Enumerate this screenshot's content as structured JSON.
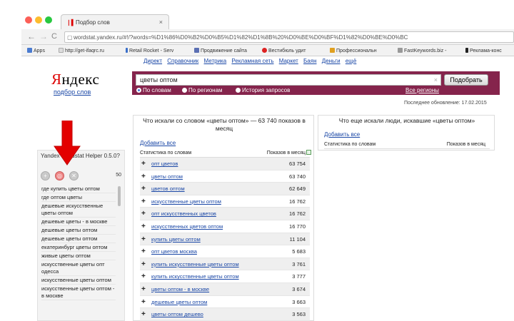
{
  "browser": {
    "tab_title": "Подбор слов",
    "tab_close": "×",
    "url": "wordstat.yandex.ru/#!/?words=%D1%86%D0%B2%D0%B5%D1%82%D1%8B%20%D0%BE%D0%BF%D1%82%D0%BE%D0%BC",
    "nav": {
      "back": "←",
      "forward": "→",
      "reload": "C"
    }
  },
  "bookmarks": [
    {
      "label": "Apps",
      "color": "#4a7bd0"
    },
    {
      "label": "http://get-ifaqrc.ru",
      "color": "#dddddd"
    },
    {
      "label": "Retail Rocket - Serv",
      "color": "#3a6fc9"
    },
    {
      "label": "Продвижение сайта",
      "color": "#5b6fb3"
    },
    {
      "label": "Вестибюль удит",
      "color": "#d22"
    },
    {
      "label": "Профессиональн",
      "color": "#e0a020"
    },
    {
      "label": "FastKeywords.biz - ",
      "color": "#999999"
    },
    {
      "label": "Реклама-конс",
      "color": "#222222"
    }
  ],
  "topnav": [
    "Директ",
    "Справочник",
    "Метрика",
    "Рекламная сеть",
    "Маркет",
    "Баян",
    "Деньги",
    "ещё"
  ],
  "logo": {
    "brand_first": "Я",
    "brand_rest": "ндекс",
    "subtitle": "подбор слов"
  },
  "search": {
    "query": "цветы оптом",
    "clear": "×",
    "submit_label": "Подобрать",
    "modes": [
      {
        "label": "По словам",
        "selected": true
      },
      {
        "label": "По регионам",
        "selected": false
      },
      {
        "label": "История запросов",
        "selected": false
      }
    ],
    "all_regions": "Все регионы"
  },
  "updated": "Последнее обновление: 17.02.2015",
  "plugin": {
    "title": "Yandex Wordstat Helper 0.5.0",
    "help": "?",
    "count": "50",
    "buttons": [
      "+",
      "◎",
      "✕"
    ],
    "items": [
      "где купить цветы оптом",
      "где оптом цветы",
      "дешевые искусственные цветы оптом",
      "дешевые цветы - в москве",
      "дешевые цветы оптом",
      "дешевые цветы оптом",
      "екатеринбург цветы оптом",
      "живые цветы оптом",
      "искусственные цветы опт одесса",
      "искусственные цветы оптом",
      "искусственные цветы оптом - в москве"
    ]
  },
  "main_table": {
    "heading": "Что искали со словом «цветы оптом» — 63 740 показов в месяц",
    "add_all": "Добавить все",
    "col_words": "Статистика по словам",
    "col_shows": "Показов в месяц",
    "rows": [
      {
        "keyword": "опт цветов",
        "count": "63 754"
      },
      {
        "keyword": "цветы оптом",
        "count": "63 740"
      },
      {
        "keyword": "цветов оптом",
        "count": "62 649"
      },
      {
        "keyword": "искусственные цветы оптом",
        "count": "16 762"
      },
      {
        "keyword": "опт искусственных цветов",
        "count": "16 762"
      },
      {
        "keyword": "искусственных цветов оптом",
        "count": "16 770"
      },
      {
        "keyword": "купить цветы оптом",
        "count": "11 104"
      },
      {
        "keyword": "опт цветов москва",
        "count": "5 683"
      },
      {
        "keyword": "купить искусственные цветы оптом",
        "count": "3 761"
      },
      {
        "keyword": "купить искусственные цветы оптом",
        "count": "3 777"
      },
      {
        "keyword": "цветы оптом - в москве",
        "count": "3 674"
      },
      {
        "keyword": "дешевые цветы оптом",
        "count": "3 663"
      },
      {
        "keyword": "цветы оптом дешево",
        "count": "3 563"
      }
    ]
  },
  "side_table": {
    "heading": "Что еще искали люди, искавшие «цветы оптом»",
    "add_all": "Добавить все",
    "col_words": "Статистика по словам",
    "col_shows": "Показов в месяц"
  }
}
